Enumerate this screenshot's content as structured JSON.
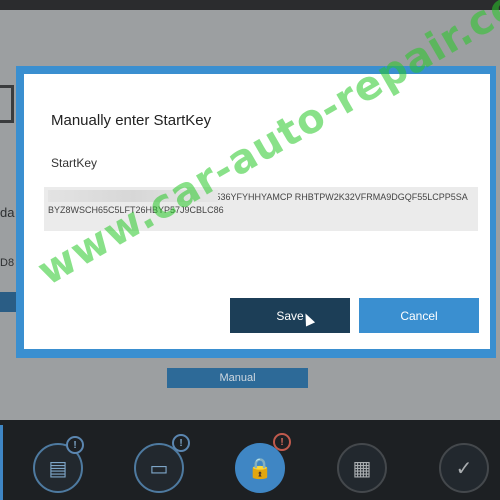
{
  "background": {
    "left_text_1": "da",
    "left_text_2": "D8",
    "manual_button": "Manual",
    "badges": [
      "!",
      "!",
      "!"
    ]
  },
  "dialog": {
    "title": "Manually enter StartKey",
    "field_label": "StartKey",
    "key_value": "GFNNFZ4Z3MFU2JGAK89K4ET8A5WSJ536YFYHHYAMCP RHBTPW2K32VFRMA9DGQF55LCPP5SABYZ8WSCH65C5LFT26HBYP57J9CBLC86",
    "save_label": "Save",
    "cancel_label": "Cancel"
  },
  "watermark": "www.car-auto-repair.com",
  "colors": {
    "accent": "#3a8fd0",
    "save": "#1c3e57",
    "taskbar": "#1d2023"
  }
}
